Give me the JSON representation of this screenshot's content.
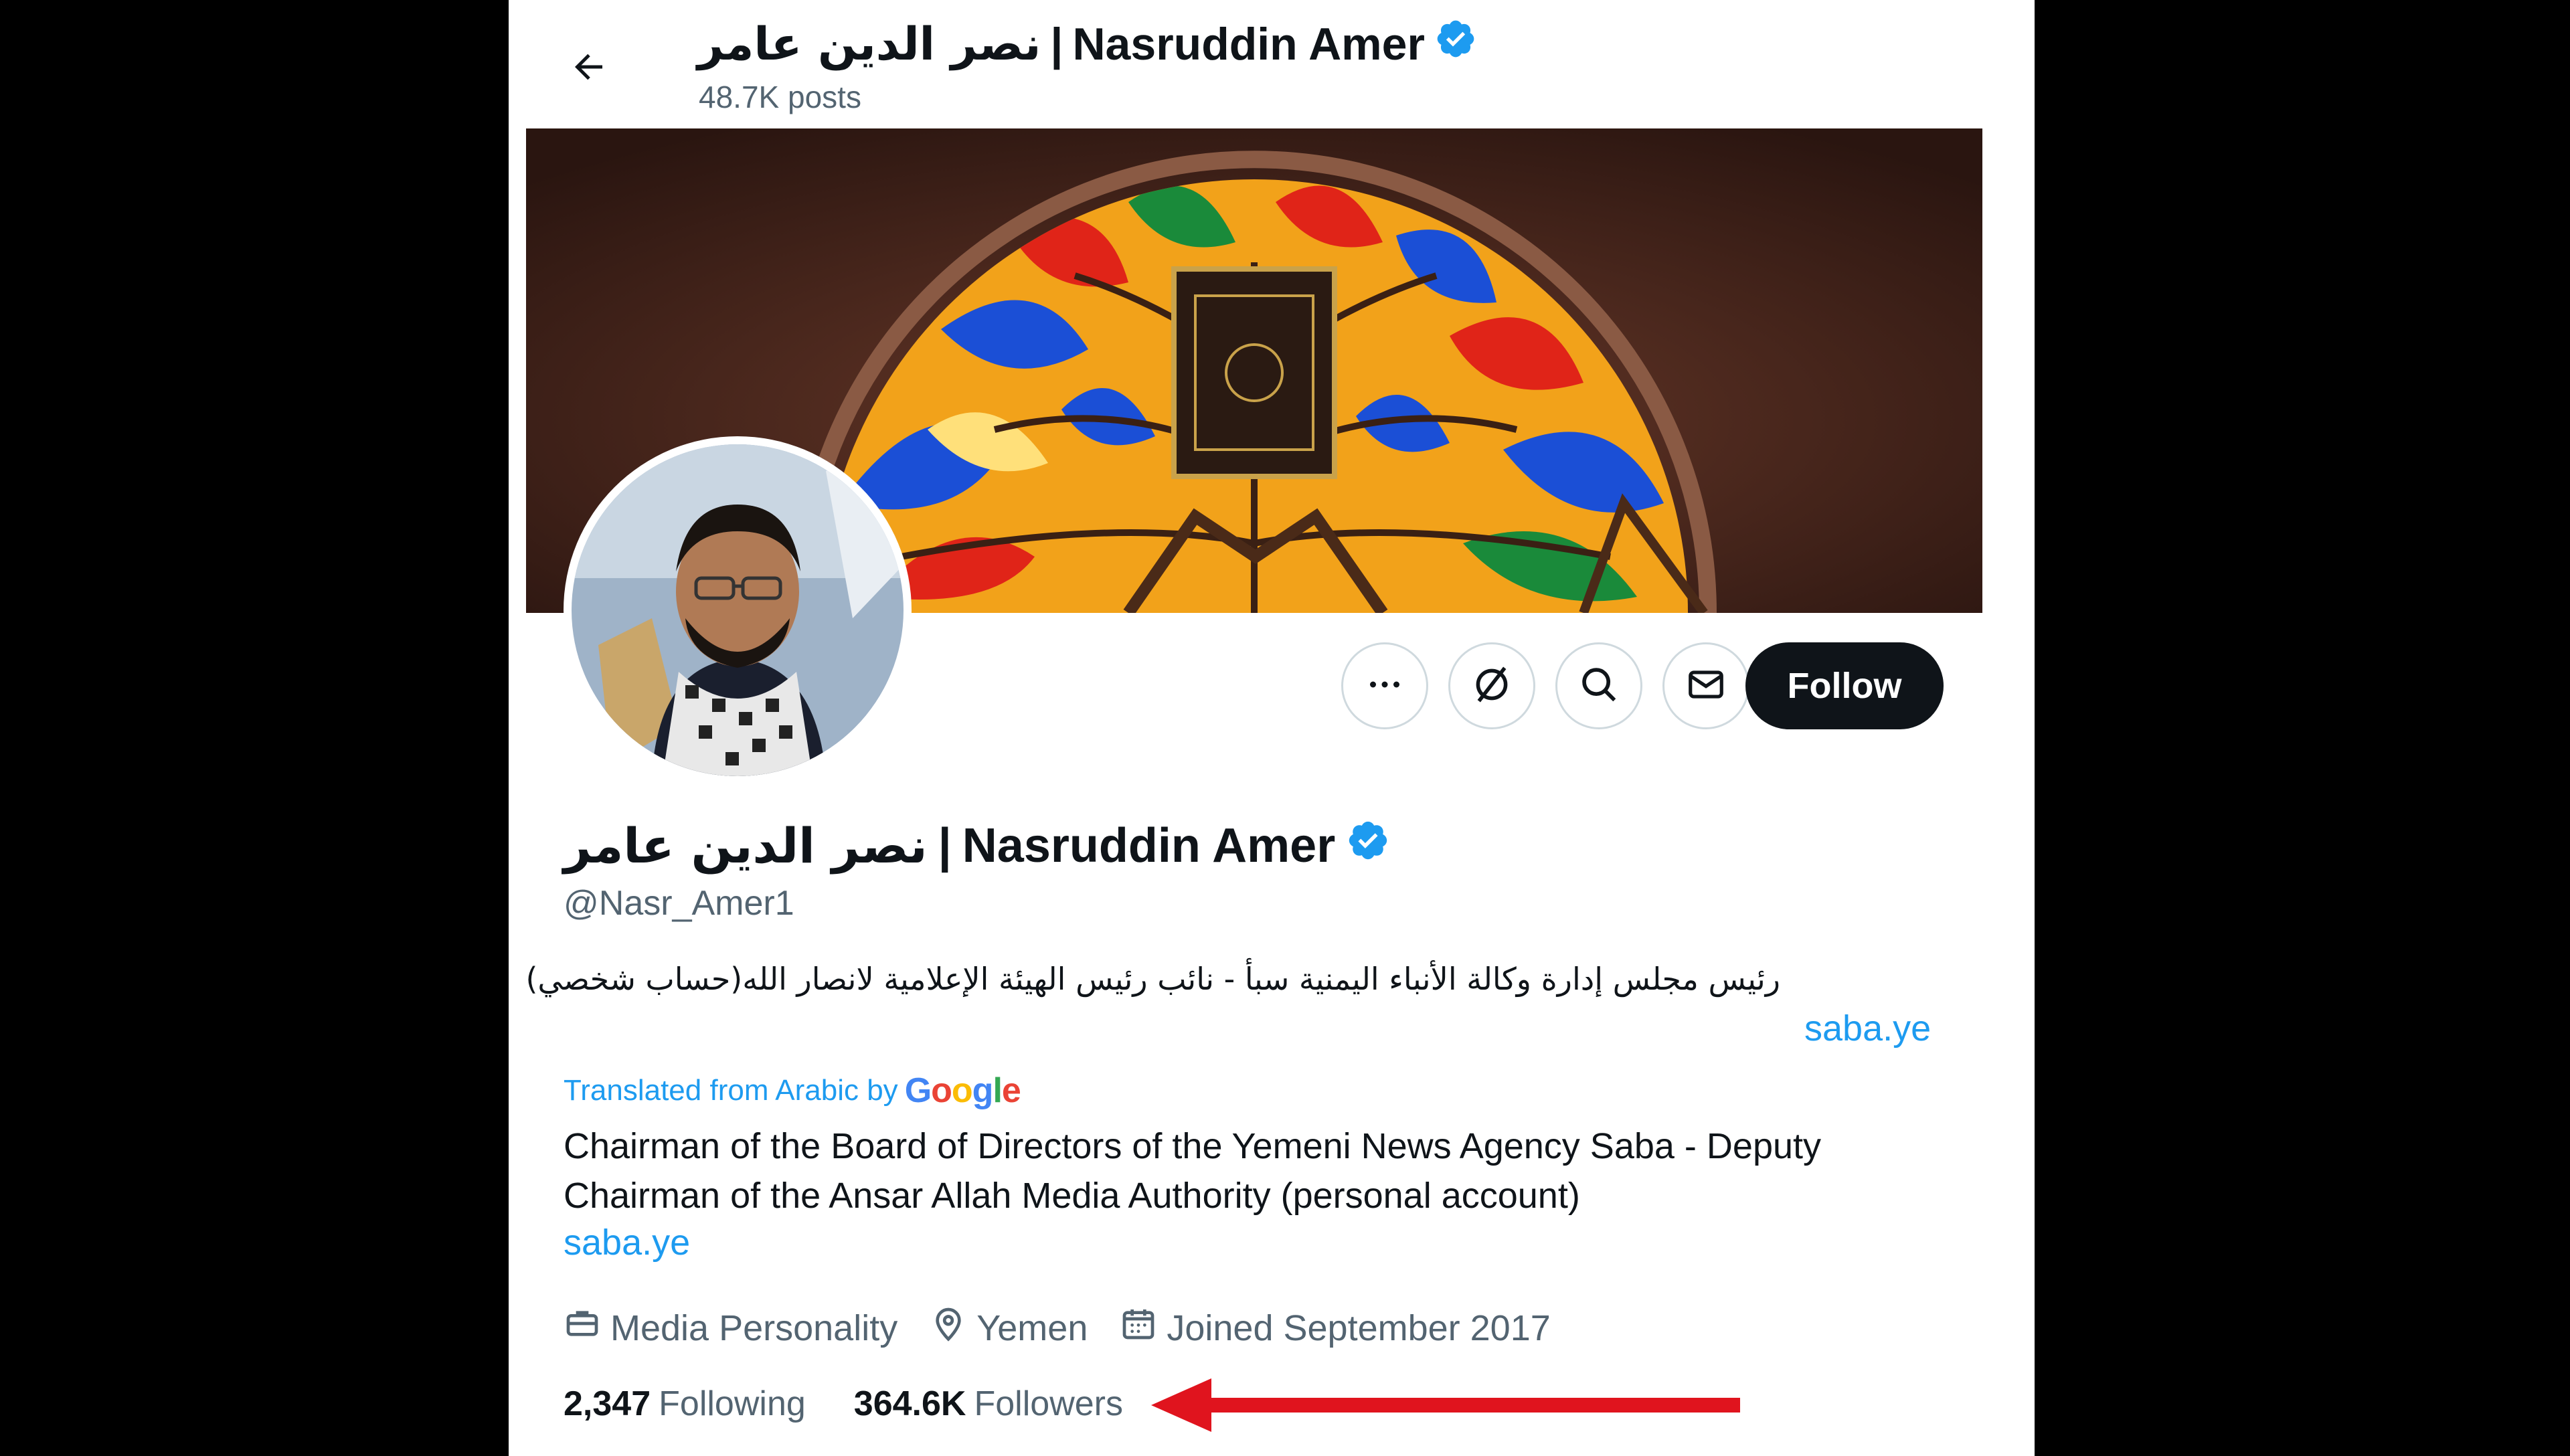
{
  "header": {
    "title_ar": "نصر الدين عامر",
    "title_sep": "|",
    "title_en": "Nasruddin Amer",
    "posts": "48.7K posts"
  },
  "profile": {
    "name_ar": "نصر الدين عامر",
    "name_sep": "|",
    "name_en": "Nasruddin Amer",
    "handle": "@Nasr_Amer1",
    "bio_ar": "رئيس مجلس إدارة وكالة الأنباء اليمنية سبأ - نائب رئيس الهيئة الإعلامية لانصار الله(حساب شخصي)",
    "link_ar": "saba.ye",
    "translated_label": "Translated from Arabic by",
    "translated_brand": "Google",
    "bio_en": "Chairman of the Board of Directors of the Yemeni News Agency Saba - Deputy Chairman of the Ansar Allah Media Authority (personal account)",
    "link_en": "saba.ye",
    "category": "Media Personality",
    "location": "Yemen",
    "joined": "Joined September 2017",
    "following_count": "2,347",
    "following_label": "Following",
    "followers_count": "364.6K",
    "followers_label": "Followers"
  },
  "actions": {
    "follow_label": "Follow"
  },
  "colors": {
    "accent": "#1d9bf0",
    "annotation_arrow": "#e0141e"
  }
}
